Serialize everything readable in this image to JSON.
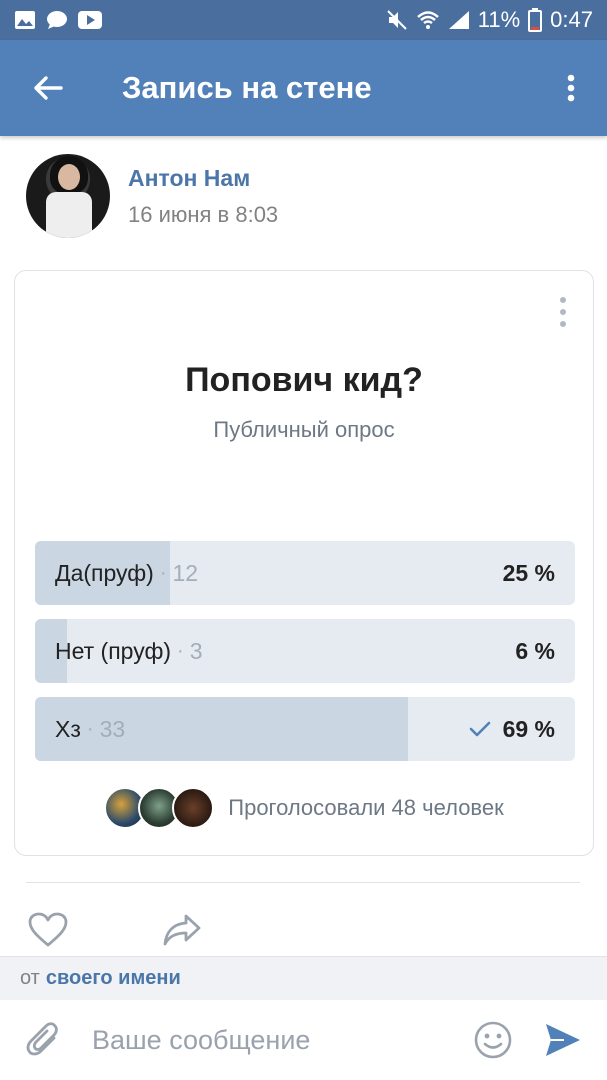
{
  "status_bar": {
    "battery": "11%",
    "time": "0:47"
  },
  "header": {
    "title": "Запись на стене"
  },
  "post": {
    "author": "Антон Нам",
    "date": "16 июня в 8:03"
  },
  "poll": {
    "question": "Попович кид?",
    "type": "Публичный опрос",
    "options": [
      {
        "label": "Да(пруф)",
        "count": "12",
        "percent": "25 %",
        "fraction": 0.25,
        "selected": false
      },
      {
        "label": "Нет (пруф)",
        "count": "3",
        "percent": "6 %",
        "fraction": 0.06,
        "selected": false
      },
      {
        "label": "Хз",
        "count": "33",
        "percent": "69 %",
        "fraction": 0.69,
        "selected": true
      }
    ],
    "voters_text": "Проголосовали 48 человек"
  },
  "from_bar": {
    "prefix": "от",
    "link": "своего имени"
  },
  "composer": {
    "placeholder": "Ваше сообщение"
  },
  "colors": {
    "header": "#5181b8",
    "status_bar": "#4a6f9e",
    "link": "#4a76a8",
    "poll_bar": "#e5ebf1",
    "poll_fill": "#cad6e2",
    "send": "#5181b8"
  }
}
